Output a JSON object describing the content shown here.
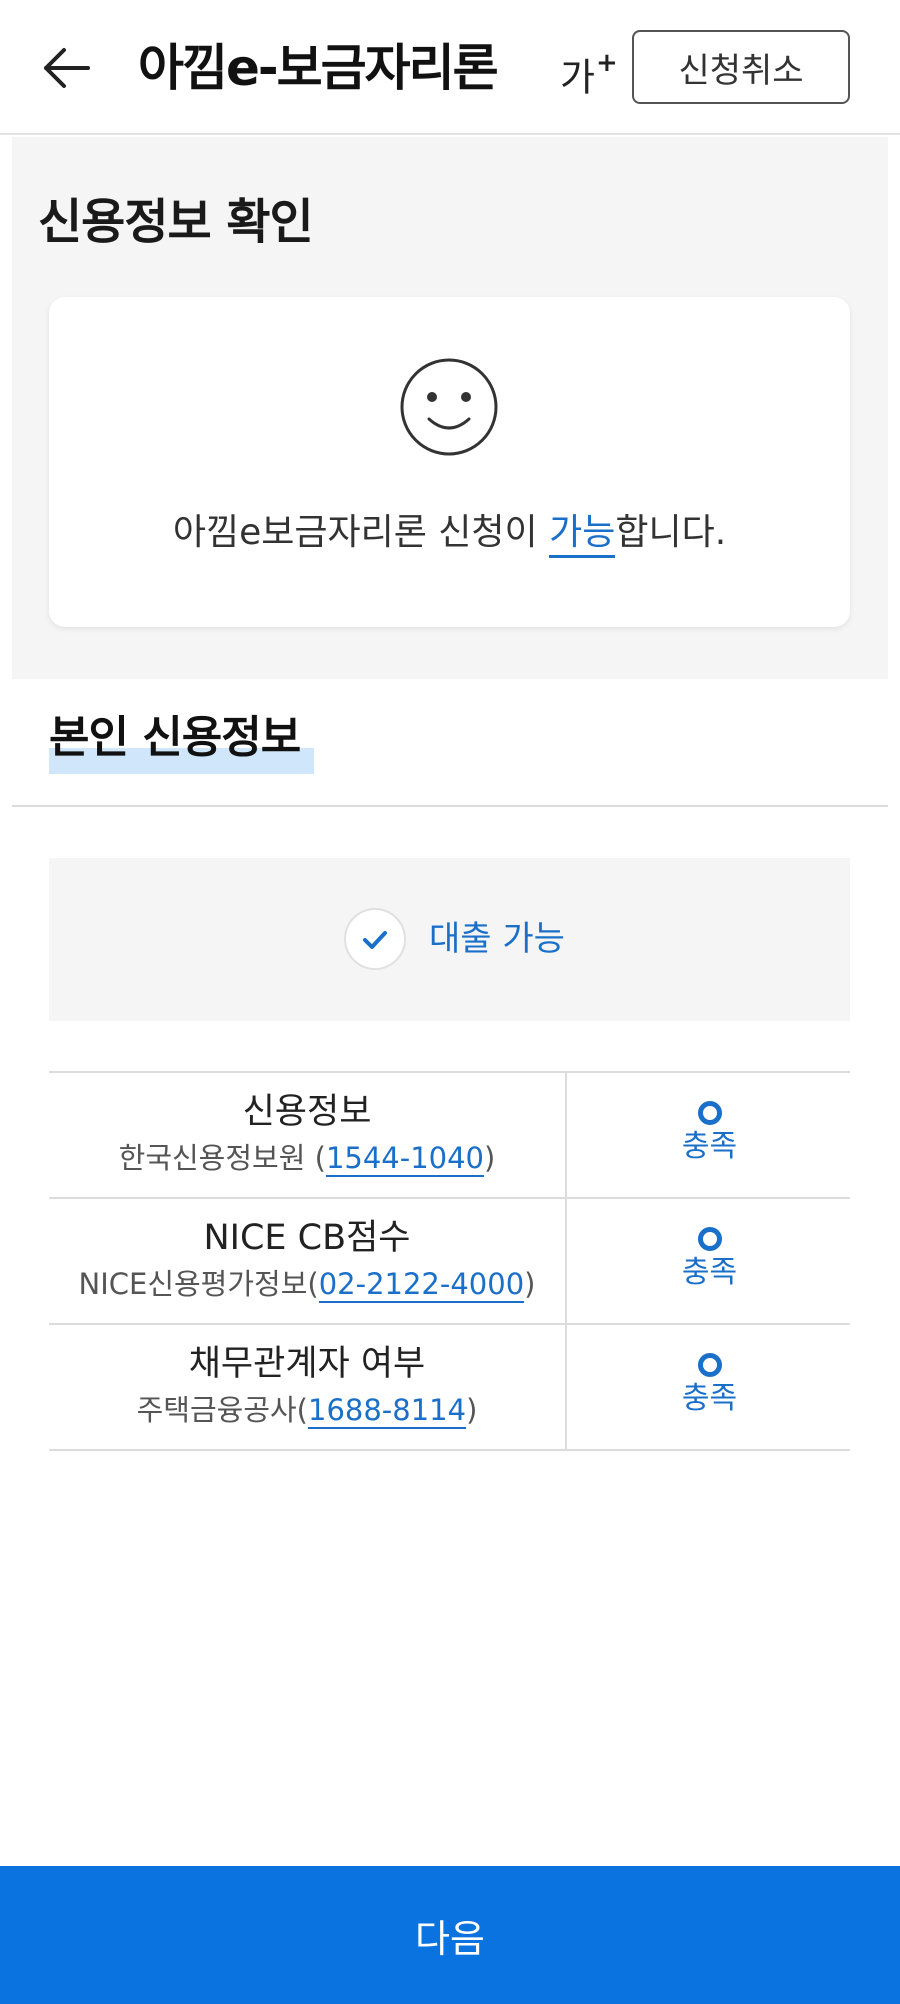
{
  "header": {
    "title": "아낌e-보금자리론",
    "font_size_label": "가",
    "font_size_plus": "+",
    "cancel_label": "신청취소"
  },
  "credit_check": {
    "title": "신용정보 확인",
    "message_prefix": "아낌e보금자리론 신청이 ",
    "message_highlight": "가능",
    "message_suffix": "합니다."
  },
  "my_credit": {
    "title": "본인 신용정보",
    "status_label": "대출 가능"
  },
  "rows": [
    {
      "name": "신용정보",
      "org": "한국신용정보원 (",
      "phone": "1544-1040",
      "close": ")",
      "mark": "O",
      "status": "충족"
    },
    {
      "name": "NICE CB점수",
      "org": "NICE신용평가정보(",
      "phone": "02-2122-4000",
      "close": ")",
      "mark": "O",
      "status": "충족"
    },
    {
      "name": "채무관계자 여부",
      "org": "주택금융공사(",
      "phone": "1688-8114",
      "close": ")",
      "mark": "O",
      "status": "충족"
    }
  ],
  "footer": {
    "next_label": "다음"
  },
  "colors": {
    "accent": "#1a6fc9",
    "button": "#0a73e0",
    "section_bg": "#f5f5f5"
  },
  "icons": [
    "back-arrow-icon",
    "smiley-icon",
    "check-icon",
    "circle-o-icon"
  ]
}
